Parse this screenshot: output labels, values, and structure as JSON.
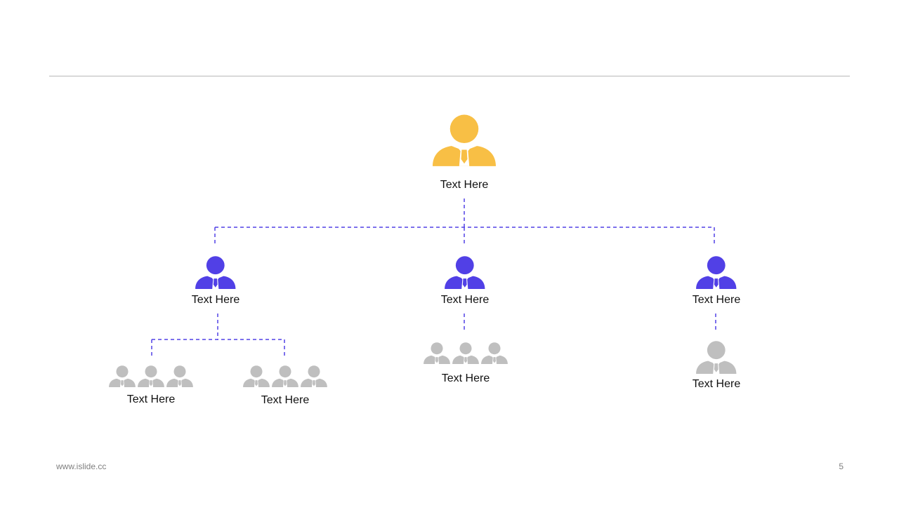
{
  "colors": {
    "leader": "#f8bf45",
    "manager": "#5140e6",
    "staff": "#bfbfbf",
    "connector": "#5140e6",
    "divider": "#b7b7b7"
  },
  "chart_data": {
    "type": "org-chart",
    "nodes": [
      {
        "id": "root",
        "label": "Text Here",
        "level": 0,
        "icon_count": 1,
        "parent": null
      },
      {
        "id": "m1",
        "label": "Text Here",
        "level": 1,
        "icon_count": 1,
        "parent": "root"
      },
      {
        "id": "m2",
        "label": "Text Here",
        "level": 1,
        "icon_count": 1,
        "parent": "root"
      },
      {
        "id": "m3",
        "label": "Text Here",
        "level": 1,
        "icon_count": 1,
        "parent": "root"
      },
      {
        "id": "t1",
        "label": "Text Here",
        "level": 2,
        "icon_count": 3,
        "parent": "m1"
      },
      {
        "id": "t2",
        "label": "Text Here",
        "level": 2,
        "icon_count": 3,
        "parent": "m1"
      },
      {
        "id": "t3",
        "label": "Text Here",
        "level": 2,
        "icon_count": 3,
        "parent": "m2"
      },
      {
        "id": "t4",
        "label": "Text Here",
        "level": 2,
        "icon_count": 1,
        "parent": "m3"
      }
    ]
  },
  "footer": {
    "url": "www.islide.cc",
    "page_number": "5"
  }
}
